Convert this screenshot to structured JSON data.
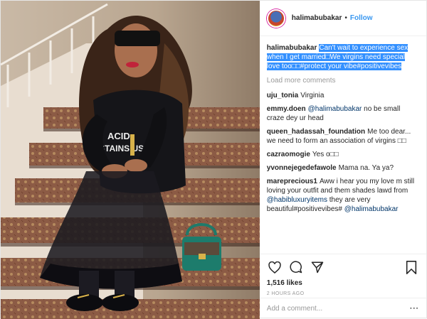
{
  "header": {
    "username": "halimabubakar",
    "separator": "•",
    "follow_label": "Follow"
  },
  "caption": {
    "username": "halimabubakar",
    "text": "Can't wait to experience sex when I get married□We virgins need special love too□□#protect your vibe#positivevibes"
  },
  "load_more": "Load more comments",
  "comments": [
    {
      "user": "uju_tonia",
      "text": "Virginia",
      "mention": "",
      "after": ""
    },
    {
      "user": "emmy.doen",
      "text": "",
      "mention": "@halimabubakar",
      "after": " no be small craze dey ur head"
    },
    {
      "user": "queen_hadassah_foundation",
      "text": "Me too dear... we need to form an association of virgins □□",
      "mention": "",
      "after": ""
    },
    {
      "user": "cazraomogie",
      "text": "Yes o□□",
      "mention": "",
      "after": ""
    },
    {
      "user": "yvonnejegedefawole",
      "text": "Mama na. Ya ya?",
      "mention": "",
      "after": ""
    },
    {
      "user": "mareprecious1",
      "text": "Aww i hear you my love m still loving your outfit and them shades lawd from ",
      "mention": "@habibluxuryitems",
      "after": " they are very beautiful#positivevibes# ",
      "mention2": "@halimabubakar"
    }
  ],
  "likes": "1,516 likes",
  "time": "2 HOURS AGO",
  "add_comment_placeholder": "Add a comment...",
  "photo_text": {
    "shirt_line1": "ACID",
    "shirt_line2": "STAINS US"
  },
  "icons": [
    "heart-icon",
    "comment-icon",
    "share-icon",
    "bookmark-icon",
    "more-icon"
  ],
  "colors": {
    "link": "#3897f0",
    "selection": "#3390ff",
    "muted": "#999999"
  }
}
